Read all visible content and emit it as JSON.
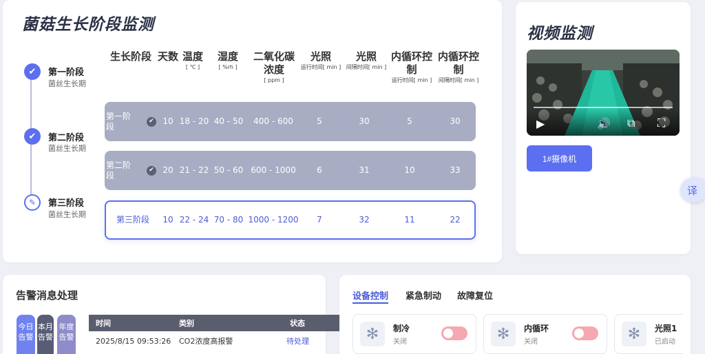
{
  "stage_panel": {
    "title": "菌菇生长阶段监测",
    "steps": [
      {
        "name": "第一阶段",
        "sub": "菌丝生长期",
        "status": "done"
      },
      {
        "name": "第二阶段",
        "sub": "菌丝生长期",
        "status": "done"
      },
      {
        "name": "第三阶段",
        "sub": "菌丝生长期",
        "status": "editing"
      }
    ],
    "headers": [
      {
        "main": "生长阶段",
        "unit": ""
      },
      {
        "main": "天数",
        "unit": ""
      },
      {
        "main": "温度",
        "unit": "[ ℃ ]"
      },
      {
        "main": "湿度",
        "unit": "[ %rh ]"
      },
      {
        "main": "二氧化碳浓度",
        "unit": "[ ppm ]"
      },
      {
        "main": "光照",
        "unit": "运行时间[ min ]"
      },
      {
        "main": "光照",
        "unit": "间隔时间[ min ]"
      },
      {
        "main": "内循环控制",
        "unit": "运行时间[ min ]"
      },
      {
        "main": "内循环控制",
        "unit": "间隔时间[ min ]"
      }
    ],
    "rows": [
      {
        "stage": "第一阶段",
        "days": "10",
        "temp": "18 - 20",
        "humidity": "40 - 50",
        "co2": "400 - 600",
        "light_run": "5",
        "light_gap": "30",
        "loop_run": "5",
        "loop_gap": "30",
        "checked": true
      },
      {
        "stage": "第二阶段",
        "days": "20",
        "temp": "21 - 22",
        "humidity": "50 - 60",
        "co2": "600 - 1000",
        "light_run": "6",
        "light_gap": "31",
        "loop_run": "10",
        "loop_gap": "33",
        "checked": true
      },
      {
        "stage": "第三阶段",
        "days": "10",
        "temp": "22 - 24",
        "humidity": "70 - 80",
        "co2": "1000 - 1200",
        "light_run": "7",
        "light_gap": "32",
        "loop_run": "11",
        "loop_gap": "22",
        "checked": false
      }
    ],
    "check_icon": "check-circle-icon",
    "accent": "#5b6ff0"
  },
  "video_panel": {
    "title": "视频监测",
    "camera_button": "1#摄像机",
    "controls": [
      "play-icon",
      "volume-icon",
      "pip-icon",
      "fullscreen-icon"
    ]
  },
  "translate_button": "译",
  "alarm_panel": {
    "title": "告警消息处理",
    "filters": [
      "今日告警",
      "本月告警",
      "年度告警"
    ],
    "columns": [
      "时间",
      "类别",
      "状态"
    ],
    "rows": [
      {
        "time": "2025/8/15 09:53:26",
        "category": "CO2浓度高报警",
        "status": "待处理"
      }
    ]
  },
  "device_panel": {
    "tabs": [
      "设备控制",
      "紧急制动",
      "故障复位"
    ],
    "active_tab": "设备控制",
    "devices": [
      {
        "name": "制冷",
        "status": "关闭",
        "on": false
      },
      {
        "name": "内循环",
        "status": "关闭",
        "on": false
      },
      {
        "name": "光照1",
        "status": "已启动",
        "on": true
      }
    ]
  }
}
